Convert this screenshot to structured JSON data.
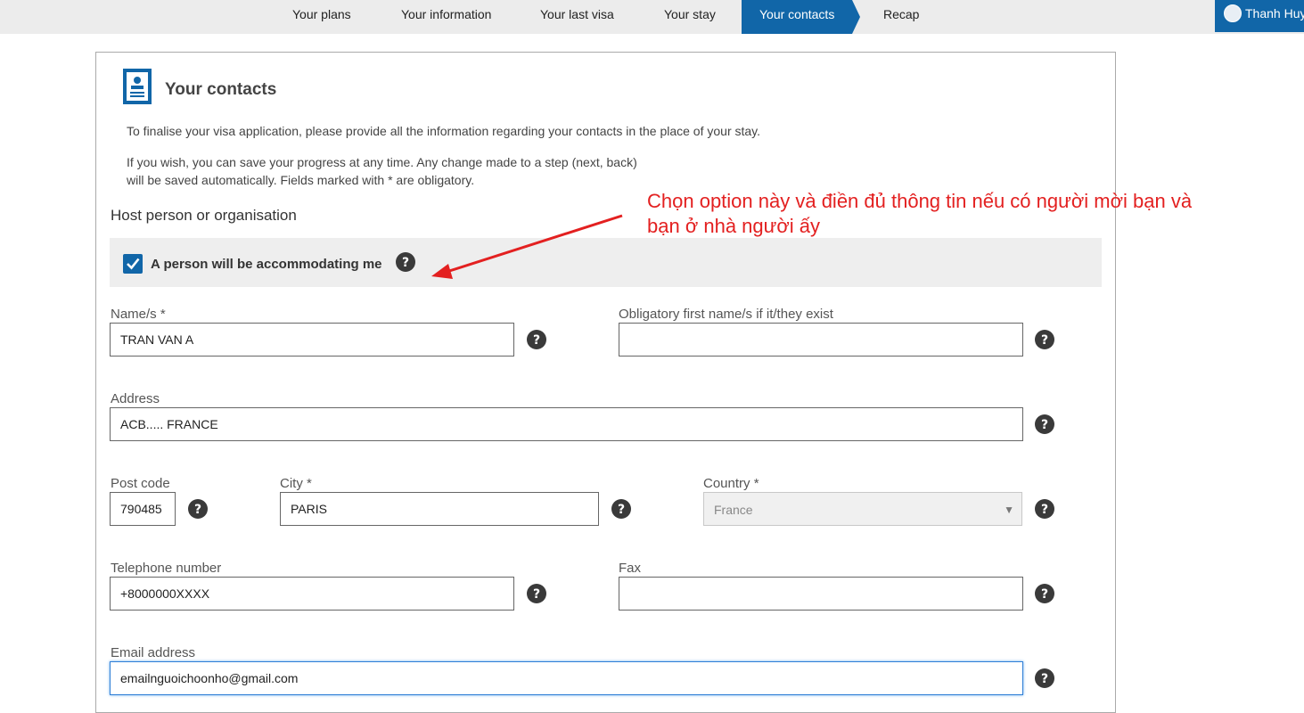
{
  "nav": {
    "steps": [
      "Your plans",
      "Your information",
      "Your last visa",
      "Your stay",
      "Your contacts",
      "Recap"
    ],
    "user_name": "Thanh Huy"
  },
  "page": {
    "title": "Your contacts",
    "intro": "To finalise your visa application, please provide all the information regarding your contacts in the place of your stay.",
    "save_note_line1": "If you wish, you can save your progress at any time. Any change made to a step (next, back)",
    "save_note_line2": "will be saved automatically. Fields marked with * are obligatory.",
    "section_title": "Host person or organisation",
    "checkbox_label": "A person will be accommodating me",
    "checkbox_checked": true
  },
  "annotation": {
    "line1": "Chọn option này và điền đủ thông tin nếu có người mời bạn và",
    "line2": "bạn ở nhà người ấy",
    "color": "#e32020"
  },
  "form": {
    "name_label": "Name/s *",
    "name_value": "TRAN VAN A",
    "first_name_label": "Obligatory first name/s if it/they exist",
    "first_name_value": "",
    "address_label": "Address",
    "address_value": "ACB..... FRANCE",
    "postcode_label": "Post code",
    "postcode_value": "790485",
    "city_label": "City *",
    "city_value": "PARIS",
    "country_label": "Country *",
    "country_value": "France",
    "phone_label": "Telephone number",
    "phone_value": "+8000000XXXX",
    "fax_label": "Fax",
    "fax_value": "",
    "email_label": "Email address",
    "email_value": "emailnguoichoonho@gmail.com"
  },
  "colors": {
    "accent": "#1166a8",
    "nav_bg": "#ececec"
  }
}
